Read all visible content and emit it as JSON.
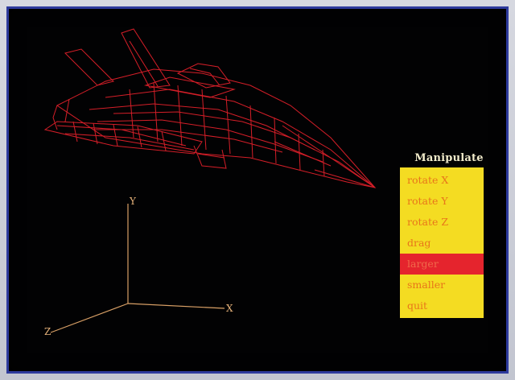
{
  "menu": {
    "title": "Manipulate",
    "items": [
      {
        "label": "rotate X",
        "active": false
      },
      {
        "label": "rotate Y",
        "active": false
      },
      {
        "label": "rotate Z",
        "active": false
      },
      {
        "label": "drag",
        "active": false
      },
      {
        "label": "larger",
        "active": true
      },
      {
        "label": "smaller",
        "active": false
      },
      {
        "label": "quit",
        "active": false
      }
    ]
  },
  "axes": {
    "x_label": "X",
    "y_label": "Y",
    "z_label": "Z"
  },
  "colors": {
    "screen_bg": "#020203",
    "bezel": "#2d3a9c",
    "wireframe": "#e0202a",
    "axis_line": "#d9a066",
    "menu_bg": "#f4dc22",
    "menu_text": "#e8751a",
    "menu_highlight": "#e5242d"
  },
  "model": {
    "name": "jet-wireframe-model"
  }
}
